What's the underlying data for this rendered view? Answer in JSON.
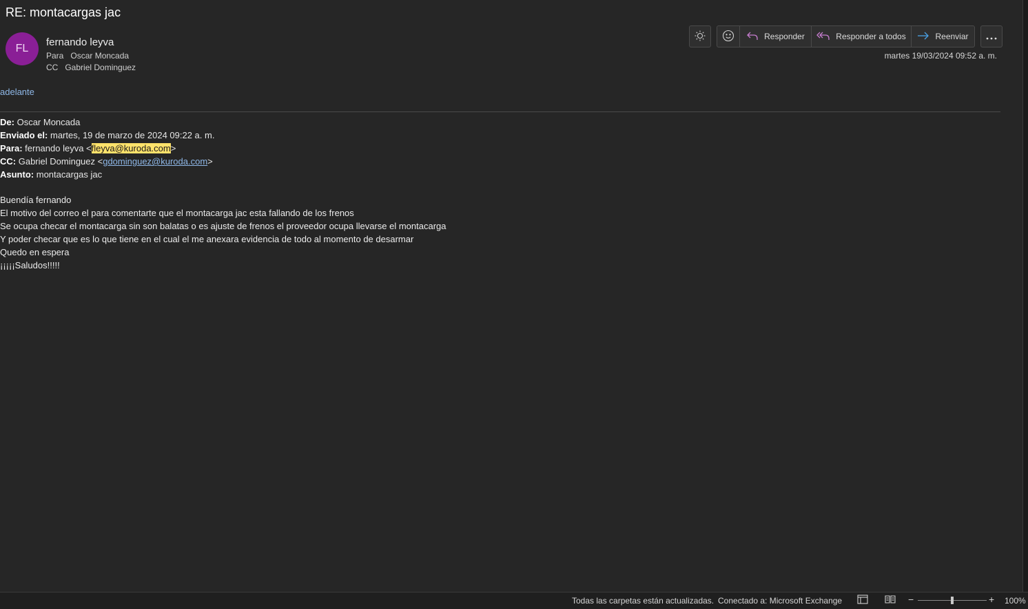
{
  "message": {
    "subject": "RE: montacargas jac",
    "avatar_initials": "FL",
    "avatar_color": "#8a1f96",
    "sender": "fernando leyva",
    "to_label": "Para",
    "to_value": "Oscar Moncada",
    "cc_label": "CC",
    "cc_value": "Gabriel Dominguez",
    "datetime": "martes 19/03/2024 09:52 a. m.",
    "top_text": "adelante"
  },
  "toolbar": {
    "theme_icon": "sun-icon",
    "emoji_icon": "smiley-icon",
    "reply_label": "Responder",
    "reply_all_label": "Responder a todos",
    "forward_label": "Reenviar",
    "more_icon": "more-icon"
  },
  "quoted": {
    "from_label": "De:",
    "from_value": "Oscar Moncada",
    "sent_label": "Enviado el:",
    "sent_value": "martes, 19 de marzo de 2024 09:22 a. m.",
    "to_label": "Para:",
    "to_name": "fernando leyva <",
    "to_email": "fleyva@kuroda.com",
    "to_close": ">",
    "cc_label": "CC:",
    "cc_name": "Gabriel Dominguez <",
    "cc_email": "gdominguez@kuroda.com",
    "cc_close": ">",
    "subject_label": "Asunto:",
    "subject_value": "montacargas jac"
  },
  "body": [
    "Buendía fernando",
    "El motivo del correo el para comentarte que el montacarga jac esta fallando de los frenos",
    "Se ocupa checar el montacarga sin son balatas o es ajuste de frenos el proveedor ocupa llevarse el montacarga",
    "Y poder checar que es lo que tiene en el cual el me anexara evidencia de todo al momento de desarmar",
    "Quedo en espera",
    "¡¡¡¡¡Saludos!!!!!"
  ],
  "status": {
    "sync_text": "Todas las carpetas están actualizadas.",
    "connection_text": "Conectado a: Microsoft Exchange",
    "zoom": "100%",
    "zoom_fraction": 0.5
  },
  "colors": {
    "background": "#262626",
    "link": "#8fb8e8",
    "highlight": "#ffe26b",
    "reply_icon": "#c77dd0",
    "forward_icon": "#4aa3e8"
  }
}
